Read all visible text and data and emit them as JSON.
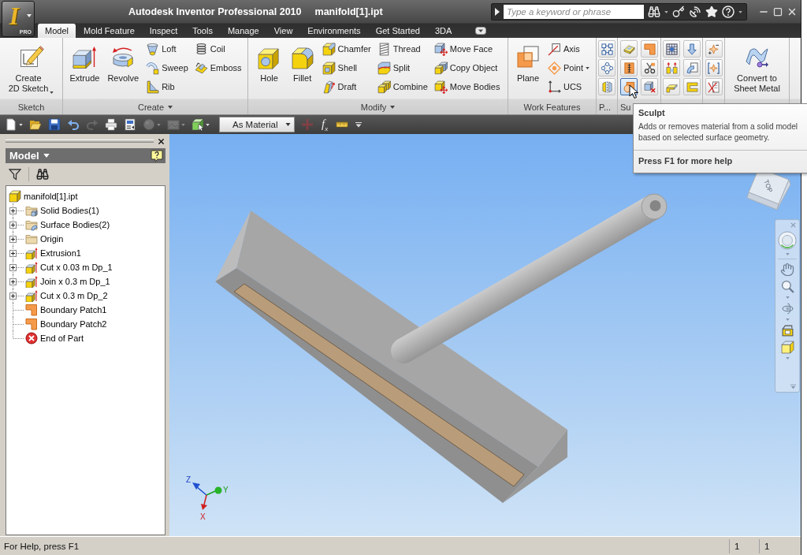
{
  "title_bar": {
    "app_button": {
      "logo": "I",
      "edition": "PRO"
    },
    "app_name": "Autodesk Inventor Professional 2010",
    "document": "manifold[1].ipt",
    "search": {
      "placeholder": "Type a keyword or phrase"
    }
  },
  "ribbon_tabs": [
    {
      "label": "Model",
      "selected": true
    },
    {
      "label": "Mold Feature",
      "selected": false
    },
    {
      "label": "Inspect",
      "selected": false
    },
    {
      "label": "Tools",
      "selected": false
    },
    {
      "label": "Manage",
      "selected": false
    },
    {
      "label": "View",
      "selected": false
    },
    {
      "label": "Environments",
      "selected": false
    },
    {
      "label": "Get Started",
      "selected": false
    },
    {
      "label": "3DA",
      "selected": false
    }
  ],
  "ribbon_panels": [
    {
      "title": "Sketch",
      "menu": false,
      "columns": [
        {
          "kind": "large",
          "buttons": [
            {
              "label": "Create\n2D Sketch",
              "dropdown": true
            }
          ]
        }
      ]
    },
    {
      "title": "Create",
      "menu": true,
      "columns": [
        {
          "kind": "large",
          "buttons": [
            {
              "label": "Extrude",
              "dropdown": false
            }
          ]
        },
        {
          "kind": "large",
          "buttons": [
            {
              "label": "Revolve",
              "dropdown": false
            }
          ]
        },
        {
          "kind": "small",
          "buttons": [
            {
              "label": "Loft",
              "dropdown": false
            },
            {
              "label": "Sweep",
              "dropdown": false
            },
            {
              "label": "Rib",
              "dropdown": false
            }
          ]
        },
        {
          "kind": "small",
          "buttons": [
            {
              "label": "Coil",
              "dropdown": false
            },
            {
              "label": "Emboss",
              "dropdown": false
            }
          ]
        }
      ]
    },
    {
      "title": "Modify",
      "menu": true,
      "columns": [
        {
          "kind": "large",
          "buttons": [
            {
              "label": "Hole",
              "dropdown": false
            }
          ]
        },
        {
          "kind": "large",
          "buttons": [
            {
              "label": "Fillet",
              "dropdown": false
            }
          ]
        },
        {
          "kind": "small",
          "buttons": [
            {
              "label": "Chamfer",
              "dropdown": false
            },
            {
              "label": "Shell",
              "dropdown": false
            },
            {
              "label": "Draft",
              "dropdown": false
            }
          ]
        },
        {
          "kind": "small",
          "buttons": [
            {
              "label": "Thread",
              "dropdown": false
            },
            {
              "label": "Split",
              "dropdown": false
            },
            {
              "label": "Combine",
              "dropdown": false
            }
          ]
        },
        {
          "kind": "small",
          "buttons": [
            {
              "label": "Move Face",
              "dropdown": false
            },
            {
              "label": "Copy Object",
              "dropdown": false
            },
            {
              "label": "Move Bodies",
              "dropdown": false
            }
          ]
        }
      ]
    },
    {
      "title": "Work Features",
      "menu": false,
      "columns": [
        {
          "kind": "large",
          "buttons": [
            {
              "label": "Plane",
              "dropdown": false
            }
          ]
        },
        {
          "kind": "small",
          "buttons": [
            {
              "label": "Axis",
              "dropdown": false
            },
            {
              "label": "Point",
              "dropdown": true
            },
            {
              "label": "UCS",
              "dropdown": false
            }
          ]
        }
      ]
    },
    {
      "title": "P...",
      "menu": false,
      "columns": [
        {
          "kind": "icon",
          "buttons": [
            {
              "hovered": false
            },
            {
              "hovered": false
            },
            {
              "hovered": false
            }
          ]
        }
      ]
    },
    {
      "title": "Su",
      "menu": false,
      "columns": [
        {
          "kind": "icon",
          "buttons": [
            {
              "hovered": false
            },
            {
              "hovered": false
            },
            {
              "hovered": true
            }
          ]
        },
        {
          "kind": "icon",
          "buttons": [
            {
              "hovered": false
            },
            {
              "hovered": false
            },
            {
              "hovered": false
            }
          ]
        }
      ]
    },
    {
      "columns": [
        {
          "kind": "icon",
          "buttons": [
            {
              "hovered": false
            },
            {
              "hovered": false
            },
            {
              "hovered": false
            }
          ]
        },
        {
          "kind": "icon",
          "buttons": [
            {
              "hovered": false
            },
            {
              "hovered": false
            },
            {
              "hovered": false
            }
          ]
        }
      ]
    },
    {
      "columns": [
        {
          "kind": "icon",
          "buttons": [
            {
              "hovered": false
            },
            {
              "hovered": false
            },
            {
              "hovered": false
            }
          ]
        }
      ]
    },
    {
      "columns": [
        {
          "kind": "large",
          "buttons": [
            {
              "label": "Convert to\nSheet Metal",
              "dropdown": false
            }
          ]
        }
      ]
    }
  ],
  "tooltip": {
    "title": "Sculpt",
    "description": "Adds or removes material from a solid model based on selected surface geometry.",
    "help": "Press F1 for more help"
  },
  "quick_access_toolbar": [
    {
      "kind": "icon",
      "disabled": false,
      "dropdown": true
    },
    {
      "kind": "icon",
      "disabled": false,
      "dropdown": false
    },
    {
      "kind": "icon",
      "disabled": false,
      "dropdown": false
    },
    {
      "kind": "icon",
      "disabled": false,
      "dropdown": false
    },
    {
      "kind": "icon",
      "disabled": true,
      "dropdown": false
    },
    {
      "kind": "icon",
      "disabled": false,
      "dropdown": false
    },
    {
      "kind": "icon",
      "disabled": false,
      "dropdown": false
    },
    {
      "kind": "icon",
      "disabled": true,
      "dropdown": true
    },
    {
      "kind": "icon",
      "disabled": true,
      "dropdown": true
    },
    {
      "kind": "icon",
      "disabled": false,
      "dropdown": true
    },
    {
      "kind": "select",
      "value": "As Material"
    },
    {
      "kind": "icon",
      "disabled": true,
      "dropdown": false
    },
    {
      "kind": "text",
      "label": "f$_{x}$",
      "disabled": false
    },
    {
      "kind": "icon",
      "disabled": false,
      "dropdown": false
    },
    {
      "kind": "menu"
    }
  ],
  "model_browser": {
    "title": "Model",
    "tree": [
      {
        "label": "manifold[1].ipt",
        "kind": "part",
        "children": [
          {
            "label": "Solid Bodies(1)",
            "kind": "solid-bodies",
            "expandable": true
          },
          {
            "label": "Surface Bodies(2)",
            "kind": "surface-bodies",
            "expandable": true
          },
          {
            "label": "Origin",
            "kind": "folder",
            "expandable": true
          },
          {
            "label": "Extrusion1",
            "kind": "extrusion",
            "expandable": true
          },
          {
            "label": "Cut x 0.03 m Dp_1",
            "kind": "extrusion",
            "expandable": true
          },
          {
            "label": "Join x 0.3 m Dp_1",
            "kind": "extrusion",
            "expandable": true
          },
          {
            "label": "Cut x 0.3 m Dp_2",
            "kind": "extrusion",
            "expandable": true
          },
          {
            "label": "Boundary Patch1",
            "kind": "patch",
            "expandable": false
          },
          {
            "label": "Boundary Patch2",
            "kind": "patch",
            "expandable": false
          },
          {
            "label": "End of Part",
            "kind": "end-of-part",
            "expandable": false
          }
        ]
      }
    ]
  },
  "view_cube": {
    "face": "TOP"
  },
  "axis_triad": {
    "z": "Z",
    "y": "Y",
    "x": "X"
  },
  "status_bar": {
    "help": "For Help, press F1",
    "fields": [
      "1",
      "1"
    ]
  }
}
